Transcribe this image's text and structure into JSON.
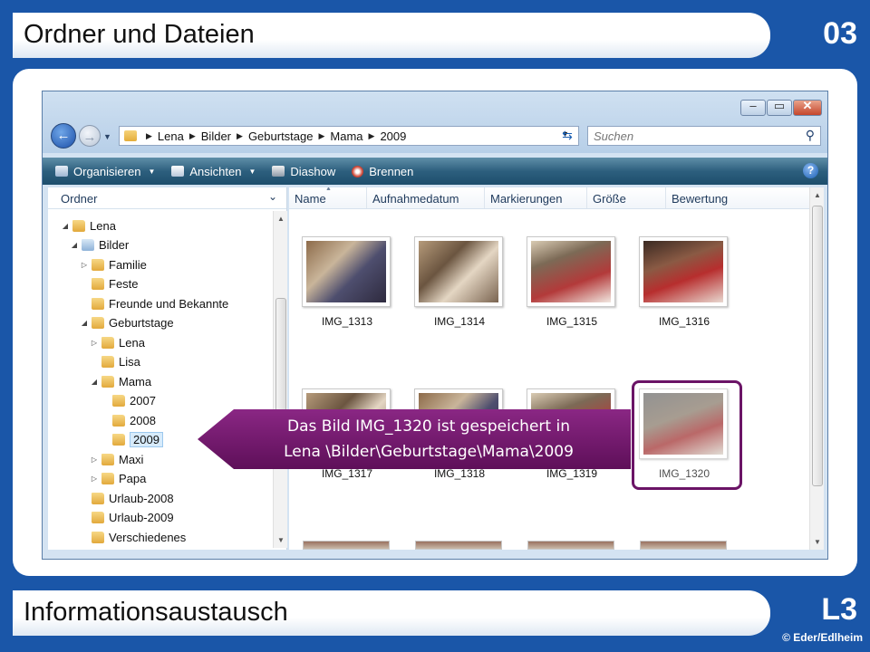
{
  "slide": {
    "title": "Ordner und Dateien",
    "number": "03",
    "footer": "Informationsaustausch",
    "level": "L3",
    "copyright": "© Eder/Edlheim"
  },
  "window": {
    "buttons": {
      "minimize": "‒",
      "maximize": "▭",
      "close": "✕"
    },
    "address": {
      "crumbs": [
        "Lena",
        "Bilder",
        "Geburtstage",
        "Mama",
        "2009"
      ]
    },
    "search": {
      "placeholder": "Suchen"
    },
    "toolbar": {
      "organize": "Organisieren",
      "views": "Ansichten",
      "slideshow": "Diashow",
      "burn": "Brennen",
      "help": "?"
    },
    "folder_pane": {
      "header": "Ordner",
      "tree": [
        {
          "label": "Lena"
        },
        {
          "label": "Bilder"
        },
        {
          "label": "Familie"
        },
        {
          "label": "Feste"
        },
        {
          "label": "Freunde und Bekannte"
        },
        {
          "label": "Geburtstage"
        },
        {
          "label": "Lena"
        },
        {
          "label": "Lisa"
        },
        {
          "label": "Mama"
        },
        {
          "label": "2007"
        },
        {
          "label": "2008"
        },
        {
          "label": "2009"
        },
        {
          "label": "Maxi"
        },
        {
          "label": "Papa"
        },
        {
          "label": "Urlaub-2008"
        },
        {
          "label": "Urlaub-2009"
        },
        {
          "label": "Verschiedenes"
        }
      ]
    },
    "columns": [
      "Name",
      "Aufnahmedatum",
      "Markierungen",
      "Größe",
      "Bewertung"
    ],
    "files": [
      {
        "name": "IMG_1313"
      },
      {
        "name": "IMG_1314"
      },
      {
        "name": "IMG_1315"
      },
      {
        "name": "IMG_1316"
      },
      {
        "name": "IMG_1317"
      },
      {
        "name": "IMG_1318"
      },
      {
        "name": "IMG_1319"
      },
      {
        "name": "IMG_1320"
      }
    ]
  },
  "callout": {
    "line1": "Das Bild IMG_1320 ist gespeichert in",
    "line2": "Lena \\Bilder\\Geburtstage\\Mama\\2009",
    "color": "#6b1466"
  }
}
